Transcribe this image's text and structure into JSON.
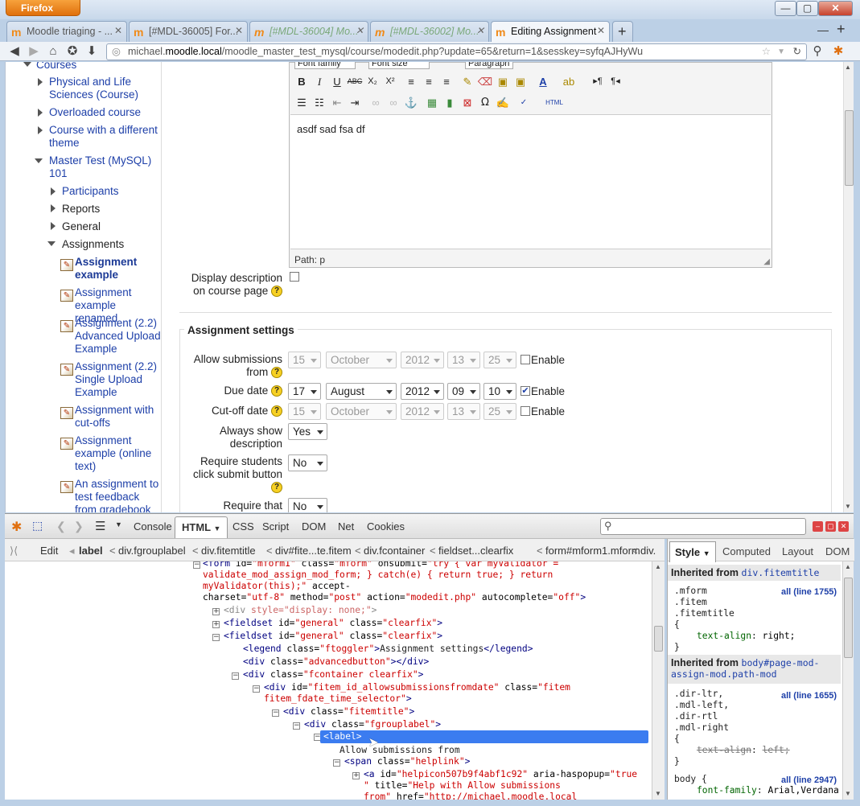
{
  "browser": {
    "app_button": "Firefox",
    "tabs": [
      {
        "label": "Moodle triaging - ..."
      },
      {
        "label": "[#MDL-36005] For..."
      },
      {
        "label": "[#MDL-36004] Mo..."
      },
      {
        "label": "[#MDL-36002] Mo..."
      },
      {
        "label": "Editing Assignment"
      }
    ],
    "url_prefix": "michael.",
    "url_host": "moodle.local",
    "url_rest": "/moodle_master_test_mysql/course/modedit.php?update=65&return=1&sesskey=syfqAJHyWu"
  },
  "sidebar": {
    "courses": "Courses",
    "items": [
      {
        "label": "Physical and Life Sciences (Course)"
      },
      {
        "label": "Overloaded course"
      },
      {
        "label": "Course with a different theme"
      },
      {
        "label": "Master Test (MySQL) 101"
      },
      {
        "label": "Participants"
      },
      {
        "label": "Reports"
      },
      {
        "label": "General"
      },
      {
        "label": "Assignments"
      },
      {
        "label": "Assignment example"
      },
      {
        "label": "Assignment example renamed"
      },
      {
        "label": "Assignment (2.2) Advanced Upload Example"
      },
      {
        "label": "Assignment (2.2) Single Upload Example"
      },
      {
        "label": "Assignment with cut-offs"
      },
      {
        "label": "Assignment example (online text)"
      },
      {
        "label": "An assignment to test feedback from gradebook"
      }
    ]
  },
  "editor": {
    "font_family": "Font family",
    "font_size": "Font size",
    "paragraph": "Paragraph",
    "content": "asdf sad fsa df",
    "path": "Path: p"
  },
  "form": {
    "display_description": "Display description on course page",
    "section_title": "Assignment settings",
    "allow_submissions_from": {
      "label": "Allow submissions from",
      "day": "15",
      "month": "October",
      "year": "2012",
      "hour": "13",
      "minute": "25",
      "enable": "Enable"
    },
    "due_date": {
      "label": "Due date",
      "day": "17",
      "month": "August",
      "year": "2012",
      "hour": "09",
      "minute": "10",
      "enable": "Enable"
    },
    "cutoff_date": {
      "label": "Cut-off date",
      "day": "15",
      "month": "October",
      "year": "2012",
      "hour": "13",
      "minute": "25",
      "enable": "Enable"
    },
    "always_show": {
      "label": "Always show description",
      "value": "Yes"
    },
    "require_submit": {
      "label": "Require students click submit button",
      "value": "No"
    },
    "require_that": {
      "label": "Require that",
      "value": "No"
    }
  },
  "firebug": {
    "tabs": [
      "Console",
      "HTML",
      "CSS",
      "Script",
      "DOM",
      "Net",
      "Cookies"
    ],
    "edit": "Edit",
    "crumbs": [
      "label",
      "div.fgrouplabel",
      "div.fitemtitle",
      "div#fite...te.fitem",
      "div.fcontainer",
      "fieldset...clearfix",
      "form#mform1.mform",
      "div."
    ],
    "side_tabs": [
      "Style",
      "Computed",
      "Layout",
      "DOM"
    ],
    "inherited_1": {
      "prefix": "Inherited from",
      "sel": "div.fitemtitle"
    },
    "rule_1": {
      "selectors": [
        ".mform",
        ".fitem",
        ".fitemtitle"
      ],
      "link": "all (line 1755)",
      "prop": "text-align",
      "value": "right;"
    },
    "inherited_2": {
      "prefix": "Inherited from",
      "sel": "body#page-mod-assign-mod.path-mod"
    },
    "rule_2": {
      "selectors": [
        ".dir-ltr,",
        ".mdl-left,",
        ".dir-rtl",
        ".mdl-right"
      ],
      "link": "all (line 1655)",
      "prop": "text-align",
      "value": "left;"
    },
    "rule_3": {
      "selector": "body {",
      "link": "all (line 2947)",
      "prop": "font-family",
      "value": "Arial,Verdana"
    }
  }
}
